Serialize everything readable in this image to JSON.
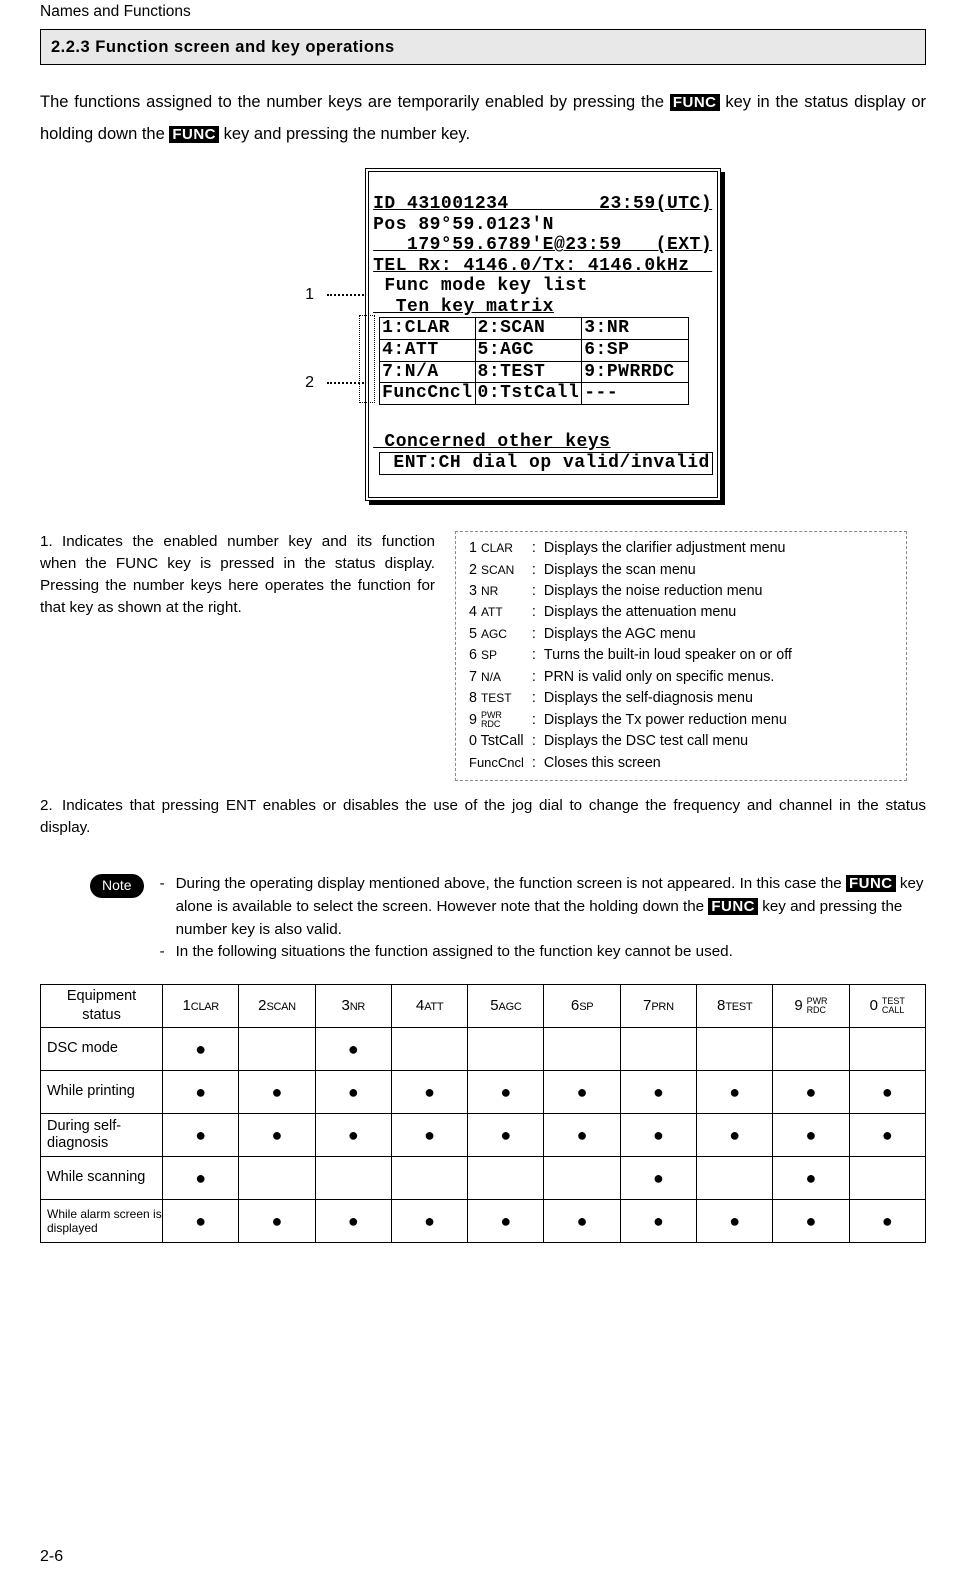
{
  "header": "Names and Functions",
  "section_title": "2.2.3    Function screen and key operations",
  "intro_part1": "The functions assigned to the number keys are temporarily enabled by pressing the ",
  "intro_key1": "FUNC",
  "intro_part2": " key in the status display or holding down the ",
  "intro_key2": "FUNC",
  "intro_part3": " key and pressing the number key.",
  "callout1": "1",
  "callout2": "2",
  "lcd": {
    "l1": "ID 431001234        23:59(UTC)",
    "l2": "Pos 89°59.0123'N",
    "l3": "   179°59.6789'E@23:59   (EXT)",
    "l4": "TEL Rx: 4146.0/Tx: 4146.0kHz  ",
    "l5": " Func mode key list",
    "l6": "  Ten key matrix",
    "t": [
      [
        "1:CLAR  ",
        "2:SCAN  ",
        "3:NR     "
      ],
      [
        "4:ATT   ",
        "5:AGC   ",
        "6:SP     "
      ],
      [
        "7:N/A   ",
        "8:TEST  ",
        "9:PWRRDC "
      ],
      [
        "FuncCncl",
        "0:TstCall",
        "---     "
      ]
    ],
    "l7": " Concerned other keys",
    "l8": " ENT:CH dial op valid/invalid"
  },
  "item1_text": "Indicates the enabled number key and its function when the FUNC key is pressed in the status display. Pressing the number keys here operates the function for that key as shown at the right.",
  "fn_list": [
    {
      "k": "1",
      "s": "CLAR",
      "d": "Displays the clarifier adjustment menu"
    },
    {
      "k": "2",
      "s": "SCAN",
      "d": "Displays the scan menu"
    },
    {
      "k": "3",
      "s": "NR",
      "d": "Displays the noise reduction menu"
    },
    {
      "k": "4",
      "s": "ATT",
      "d": "Displays the attenuation menu"
    },
    {
      "k": "5",
      "s": "AGC",
      "d": "Displays the AGC menu"
    },
    {
      "k": "6",
      "s": "SP",
      "d": "Turns the built-in loud speaker on or off"
    },
    {
      "k": "7",
      "s": "N/A",
      "d": "PRN is valid only on specific menus."
    },
    {
      "k": "8",
      "s": "TEST",
      "d": "Displays the self-diagnosis menu"
    }
  ],
  "fn_item9_k": "9",
  "fn_item9_s1": "PWR",
  "fn_item9_s2": "RDC",
  "fn_item9_d": "Displays the Tx power reduction menu",
  "fn_item10_k": "0 TstCall",
  "fn_item10_d": "Displays the DSC test call menu",
  "fn_item11_k": "FuncCncl",
  "fn_item11_d": "Closes this screen",
  "item2_text": "Indicates that pressing ENT enables or disables the use of the jog dial to change the frequency and channel in the status display.",
  "note_label": "Note",
  "note1a": "During the operating display mentioned above, the function screen is not appeared. In this case the ",
  "note1b": " key alone is available to select the screen. However note that the holding down the ",
  "note1c": " key and pressing the number key is also valid.",
  "note2": "In the following situations the function assigned to the function key cannot be used.",
  "stat_header": {
    "h0": "Equipment status",
    "cols": [
      {
        "n": "1",
        "s": "CLAR"
      },
      {
        "n": "2",
        "s": "SCAN"
      },
      {
        "n": "3",
        "s": "NR"
      },
      {
        "n": "4",
        "s": "ATT"
      },
      {
        "n": "5",
        "s": "AGC"
      },
      {
        "n": "6",
        "s": "SP"
      },
      {
        "n": "7",
        "s": "PRN"
      },
      {
        "n": "8",
        "s": "TEST"
      }
    ],
    "h9_n": "9",
    "h9_s1": "PWR",
    "h9_s2": "RDC",
    "h10_n": "0",
    "h10_s1": "TEST",
    "h10_s2": "CALL"
  },
  "stat_rows": [
    {
      "label": "DSC mode",
      "cells": [
        1,
        0,
        1,
        0,
        0,
        0,
        0,
        0,
        0,
        0
      ]
    },
    {
      "label": "While printing",
      "cells": [
        1,
        1,
        1,
        1,
        1,
        1,
        1,
        1,
        1,
        1
      ]
    },
    {
      "label": "During self-diagnosis",
      "cells": [
        1,
        1,
        1,
        1,
        1,
        1,
        1,
        1,
        1,
        1
      ]
    },
    {
      "label": "While scanning",
      "cells": [
        1,
        0,
        0,
        0,
        0,
        0,
        1,
        0,
        1,
        0
      ]
    },
    {
      "label": "While alarm screen is displayed",
      "small": true,
      "cells": [
        1,
        1,
        1,
        1,
        1,
        1,
        1,
        1,
        1,
        1
      ]
    }
  ],
  "page_number": "2-6"
}
